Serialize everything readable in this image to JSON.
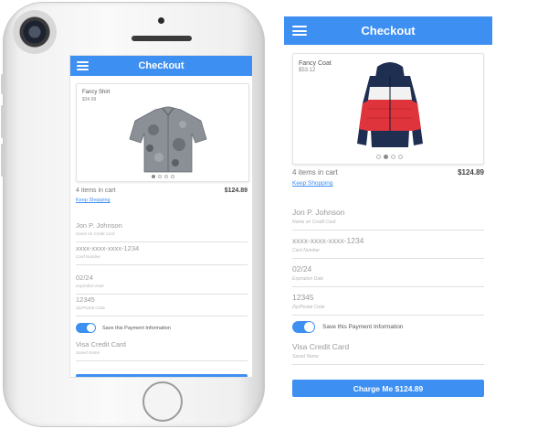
{
  "colors": {
    "accent": "#3d8ff2"
  },
  "phone_view": {
    "title": "Checkout",
    "product": {
      "name": "Fancy Shirt",
      "price": "$34.99",
      "image": "shirt-image"
    },
    "cart": {
      "count": "4 items in cart",
      "total": "$124.89",
      "keep_shopping": "Keep Shopping"
    },
    "fields": [
      {
        "value": "Jon P. Johnson",
        "hint": "Name on Credit Card"
      },
      {
        "value": "xxxx-xxxx-xxxx-1234",
        "hint": "Card Number"
      },
      {
        "value": "02/24",
        "hint": "Expiration Date"
      },
      {
        "value": "12345",
        "hint": "Zip/Postal Code"
      }
    ],
    "save_payment_label": "Save this Payment Information",
    "saved_name": {
      "value": "Visa Credit Card",
      "hint": "Saved Name"
    }
  },
  "desktop_view": {
    "title": "Checkout",
    "product": {
      "name": "Fancy Coat",
      "price": "$53.12",
      "image": "coat-image"
    },
    "cart": {
      "count": "4 items in cart",
      "total": "$124.89",
      "keep_shopping": "Keep Shopping"
    },
    "fields": [
      {
        "value": "Jon P. Johnson",
        "hint": "Name on Credit Card"
      },
      {
        "value": "xxxx-xxxx-xxxx-1234",
        "hint": "Card Number"
      },
      {
        "value": "02/24",
        "hint": "Expiration Date"
      },
      {
        "value": "12345",
        "hint": "Zip/Postal Code"
      }
    ],
    "save_payment_label": "Save this Payment Information",
    "saved_name": {
      "value": "Visa Credit Card",
      "hint": "Saved Name"
    },
    "charge_button": "Charge Me $124.89"
  }
}
